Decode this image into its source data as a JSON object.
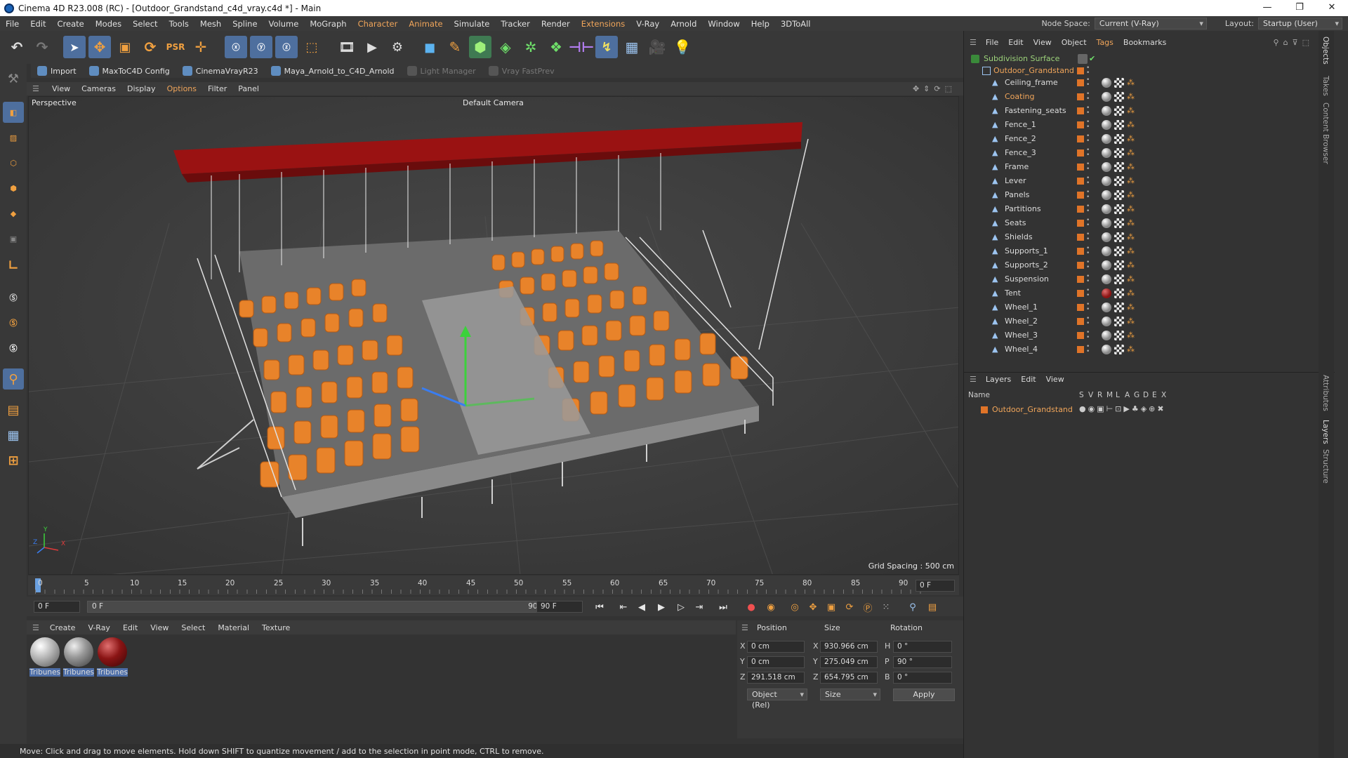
{
  "window": {
    "title": "Cinema 4D R23.008 (RC) - [Outdoor_Grandstand_c4d_vray.c4d *] - Main",
    "controls": [
      "—",
      "❐",
      "✕"
    ]
  },
  "menubar": {
    "items": [
      "File",
      "Edit",
      "Create",
      "Modes",
      "Select",
      "Tools",
      "Mesh",
      "Spline",
      "Volume",
      "MoGraph",
      "Character",
      "Animate",
      "Simulate",
      "Tracker",
      "Render",
      "Extensions",
      "V-Ray",
      "Arnold",
      "Window",
      "Help",
      "3DToAll"
    ],
    "highlighted": [
      "Character",
      "Extensions"
    ],
    "node_space_label": "Node Space:",
    "node_space_value": "Current (V-Ray)",
    "layout_label": "Layout:",
    "layout_value": "Startup (User)"
  },
  "plugins_bar": {
    "items": [
      {
        "label": "Import",
        "enabled": true
      },
      {
        "label": "MaxToC4D Config",
        "enabled": true
      },
      {
        "label": "CinemaVrayR23",
        "enabled": true
      },
      {
        "label": "Maya_Arnold_to_C4D_Arnold",
        "enabled": true
      },
      {
        "label": "Light Manager",
        "enabled": false
      },
      {
        "label": "Vray FastPrev",
        "enabled": false
      }
    ]
  },
  "viewport": {
    "menu": [
      "View",
      "Cameras",
      "Display",
      "Options",
      "Filter",
      "Panel"
    ],
    "menu_highlight": "Options",
    "name": "Perspective",
    "camera": "Default Camera",
    "grid_spacing": "Grid Spacing : 500 cm",
    "axis_labels": {
      "y": "Y",
      "z": "Z",
      "x": "X"
    }
  },
  "timeline": {
    "ticks": [
      "0",
      "5",
      "10",
      "15",
      "20",
      "25",
      "30",
      "35",
      "40",
      "45",
      "50",
      "55",
      "60",
      "65",
      "70",
      "75",
      "80",
      "85",
      "90"
    ],
    "current_frame_display": "0 F"
  },
  "playbar": {
    "start_frame": "0 F",
    "range_start": "0 F",
    "range_end": "90 F",
    "end_frame": "90 F"
  },
  "material_manager": {
    "menu": [
      "Create",
      "V-Ray",
      "Edit",
      "View",
      "Select",
      "Material",
      "Texture"
    ],
    "materials": [
      {
        "name": "Tribunes",
        "color": "#c9c9c9"
      },
      {
        "name": "Tribunes",
        "color": "#a8a8a8"
      },
      {
        "name": "Tribunes",
        "color": "#8a1414"
      }
    ]
  },
  "coordinates": {
    "headers": {
      "position": "Position",
      "size": "Size",
      "rotation": "Rotation"
    },
    "rows": [
      {
        "axis": "X",
        "pos": "0 cm",
        "size_axis": "X",
        "size": "930.966 cm",
        "rot_axis": "H",
        "rot": "0 °"
      },
      {
        "axis": "Y",
        "pos": "0 cm",
        "size_axis": "Y",
        "size": "275.049 cm",
        "rot_axis": "P",
        "rot": "90 °"
      },
      {
        "axis": "Z",
        "pos": "291.518 cm",
        "size_axis": "Z",
        "size": "654.795 cm",
        "rot_axis": "B",
        "rot": "0 °"
      }
    ],
    "mode_dropdown": "Object (Rel)",
    "size_dropdown": "Size",
    "apply_label": "Apply"
  },
  "status": {
    "text": "Move: Click and drag to move elements. Hold down SHIFT to quantize movement / add to the selection in point mode, CTRL to remove."
  },
  "object_manager": {
    "menu": [
      "File",
      "Edit",
      "View",
      "Object",
      "Tags",
      "Bookmarks"
    ],
    "menu_highlight": "Tags",
    "root": "Subdivision Surface",
    "group": "Outdoor_Grandstand",
    "objects": [
      "Ceiling_frame",
      "Coating",
      "Fastening_seats",
      "Fence_1",
      "Fence_2",
      "Fence_3",
      "Frame",
      "Lever",
      "Panels",
      "Partitions",
      "Seats",
      "Shields",
      "Supports_1",
      "Supports_2",
      "Suspension",
      "Tent",
      "Wheel_1",
      "Wheel_2",
      "Wheel_3",
      "Wheel_4"
    ],
    "highlighted_object": "Coating"
  },
  "layer_manager": {
    "menu": [
      "Layers",
      "Edit",
      "View"
    ],
    "columns": [
      "Name",
      "S",
      "V",
      "R",
      "M",
      "L",
      "A",
      "G",
      "D",
      "E",
      "X"
    ],
    "layers": [
      {
        "name": "Outdoor_Grandstand",
        "color": "#e07428"
      }
    ]
  },
  "side_tabs": [
    "Objects",
    "Takes",
    "Content Browser",
    "Attributes",
    "Layers",
    "Structure"
  ],
  "colors": {
    "accent": "#f0a55a",
    "seat_orange": "#e8832a",
    "roof_red": "#9a1212",
    "layer_orange": "#e07428"
  }
}
